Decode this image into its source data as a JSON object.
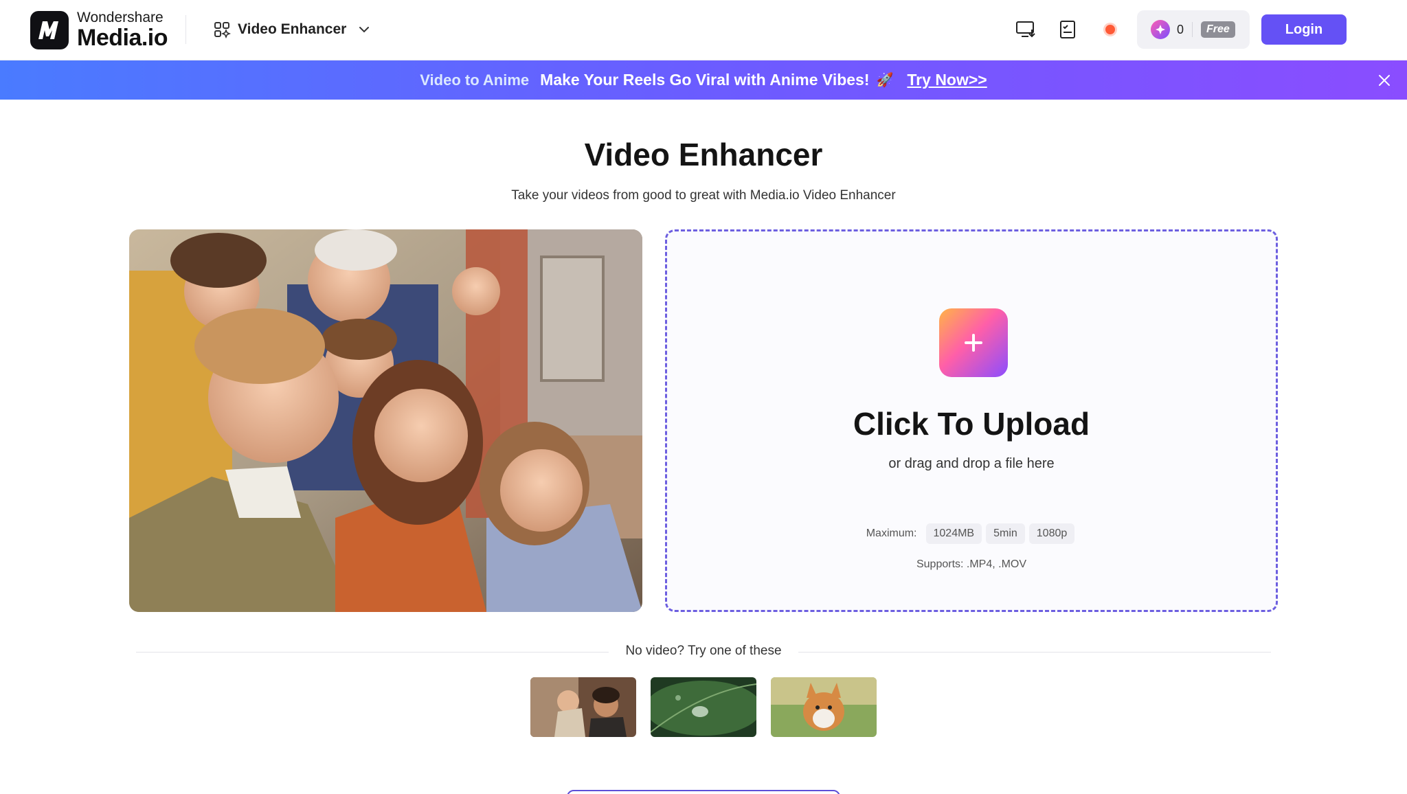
{
  "header": {
    "brand": "Wondershare",
    "product": "Media.io",
    "tool_label": "Video Enhancer",
    "credits_count": "0",
    "plan_badge": "Free",
    "login_label": "Login"
  },
  "banner": {
    "title": "Video to Anime",
    "message": "Make Your Reels Go Viral with Anime Vibes!",
    "emoji": "🚀",
    "cta": "Try Now>>"
  },
  "main": {
    "title": "Video Enhancer",
    "subtitle": "Take your videos from good to great with Media.io Video Enhancer"
  },
  "upload": {
    "title": "Click To Upload",
    "subtitle": "or drag and drop a file here",
    "max_label": "Maximum:",
    "limits": [
      "1024MB",
      "5min",
      "1080p"
    ],
    "formats": "Supports: .MP4, .MOV"
  },
  "samples": {
    "label": "No video? Try one of these"
  },
  "colors": {
    "accent": "#6451f5",
    "banner_start": "#4a7bff",
    "banner_end": "#8a4dff",
    "upload_border": "#6d5fe0"
  },
  "icons": {
    "logo": "media-io-logo",
    "tool_switch": "grid-icon",
    "dropdown": "chevron-down-icon",
    "desktop": "desktop-download-icon",
    "tasks": "task-list-icon",
    "status": "status-dot-icon",
    "credits": "gem-icon",
    "banner_close": "close-icon",
    "upload": "plus-icon"
  }
}
